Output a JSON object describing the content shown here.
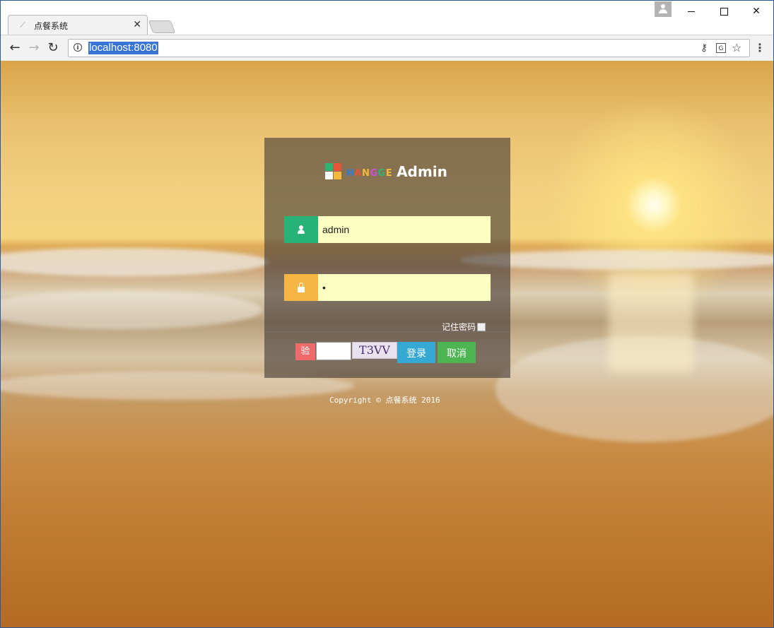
{
  "browser": {
    "tab_title": "点餐系统",
    "tab_close": "✕",
    "url": "localhost:8080",
    "icons": [
      "tab-favicon",
      "back-arrow-icon",
      "forward-arrow-icon",
      "reload-icon",
      "info-icon",
      "key-icon",
      "translate-icon",
      "star-icon",
      "menu-dots-icon",
      "user-icon",
      "minimize-icon",
      "maximize-icon",
      "close-icon"
    ]
  },
  "login": {
    "logo_letters": [
      {
        "char": "H",
        "color": "#2f7bd8"
      },
      {
        "char": "A",
        "color": "#e5553a"
      },
      {
        "char": "N",
        "color": "#f4b83c"
      },
      {
        "char": "G",
        "color": "#c94fd4"
      },
      {
        "char": "G",
        "color": "#2fb474"
      },
      {
        "char": "E",
        "color": "#f4b83c"
      }
    ],
    "logo_admin": "Admin",
    "username_value": "admin",
    "password_value": "•",
    "remember_label": "记住密码",
    "captcha_badge": "验",
    "captcha_code": "T3VV",
    "login_button": "登录",
    "cancel_button": "取消"
  },
  "footer": {
    "copyright": "Copyright © 点餐系统 2016"
  },
  "colors": {
    "user_icon_bg": "#27b377",
    "pass_icon_bg": "#f7b544",
    "input_bg": "#fbffc1",
    "login_btn": "#35a9d4",
    "cancel_btn": "#4cb552",
    "captcha_badge": "#f06a6a"
  }
}
